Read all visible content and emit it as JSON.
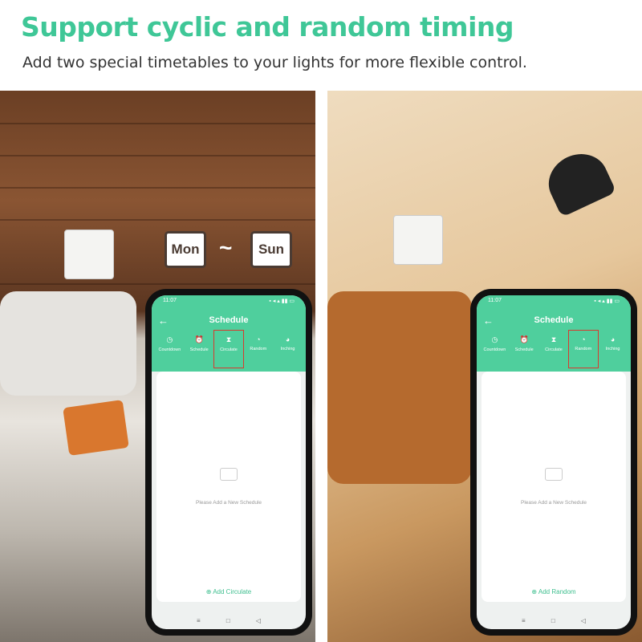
{
  "title": "Support cyclic and random timing",
  "subtitle": "Add two special timetables to your lights for more flexible control.",
  "calendar": {
    "start": "Mon",
    "separator": "~",
    "end": "Sun"
  },
  "accent": "#4fcf9d",
  "highlight": "#d83a2e",
  "phones": [
    {
      "time": "11:07",
      "header": "Schedule",
      "tabs": [
        "Countdown",
        "Schedule",
        "Circulate",
        "Random",
        "Inching"
      ],
      "selected_tab": "Circulate",
      "empty_text": "Please Add a New Schedule",
      "add_label": "Add Circulate"
    },
    {
      "time": "11:07",
      "header": "Schedule",
      "tabs": [
        "Countdown",
        "Schedule",
        "Circulate",
        "Random",
        "Inching"
      ],
      "selected_tab": "Random",
      "empty_text": "Please Add a New Schedule",
      "add_label": "Add Random"
    }
  ]
}
